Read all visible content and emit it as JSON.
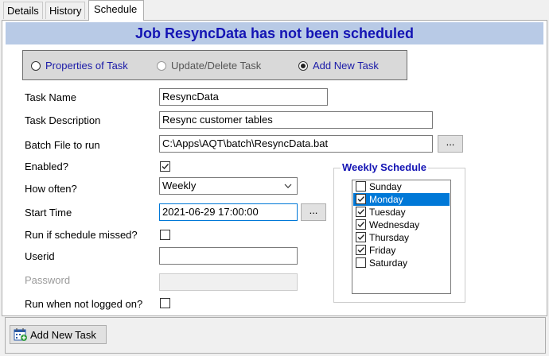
{
  "tabs": [
    {
      "label": "Details",
      "active": false
    },
    {
      "label": "History",
      "active": false
    },
    {
      "label": "Schedule",
      "active": true
    }
  ],
  "banner": "Job ResyncData has not been scheduled",
  "modes": [
    {
      "label": "Properties of Task",
      "selected": false,
      "enabled": true
    },
    {
      "label": "Update/Delete Task",
      "selected": false,
      "enabled": false
    },
    {
      "label": "Add New Task",
      "selected": true,
      "enabled": true
    }
  ],
  "form": {
    "task_name_label": "Task Name",
    "task_name": "ResyncData",
    "task_description_label": "Task Description",
    "task_description": "Resync customer tables",
    "batch_file_label": "Batch File to run",
    "batch_file": "C:\\Apps\\AQT\\batch\\ResyncData.bat",
    "browse_label": "...",
    "enabled_label": "Enabled?",
    "enabled": true,
    "how_often_label": "How often?",
    "how_often": "Weekly",
    "start_time_label": "Start Time",
    "start_time": "2021-06-29 17:00:00",
    "start_time_picker_label": "...",
    "run_if_missed_label": "Run if schedule missed?",
    "run_if_missed": false,
    "userid_label": "Userid",
    "userid": "",
    "password_label": "Password",
    "password": "",
    "run_not_logged_label": "Run when not logged on?",
    "run_not_logged": false
  },
  "weekly": {
    "title": "Weekly Schedule",
    "days": [
      {
        "label": "Sunday",
        "checked": false,
        "selected": false
      },
      {
        "label": "Monday",
        "checked": true,
        "selected": true
      },
      {
        "label": "Tuesday",
        "checked": true,
        "selected": false
      },
      {
        "label": "Wednesday",
        "checked": true,
        "selected": false
      },
      {
        "label": "Thursday",
        "checked": true,
        "selected": false
      },
      {
        "label": "Friday",
        "checked": true,
        "selected": false
      },
      {
        "label": "Saturday",
        "checked": false,
        "selected": false
      }
    ]
  },
  "actions": {
    "add_task_label": "Add New Task"
  },
  "colors": {
    "banner_bg": "#b8cae6",
    "banner_text": "#1414b4",
    "selection": "#0078d7"
  }
}
